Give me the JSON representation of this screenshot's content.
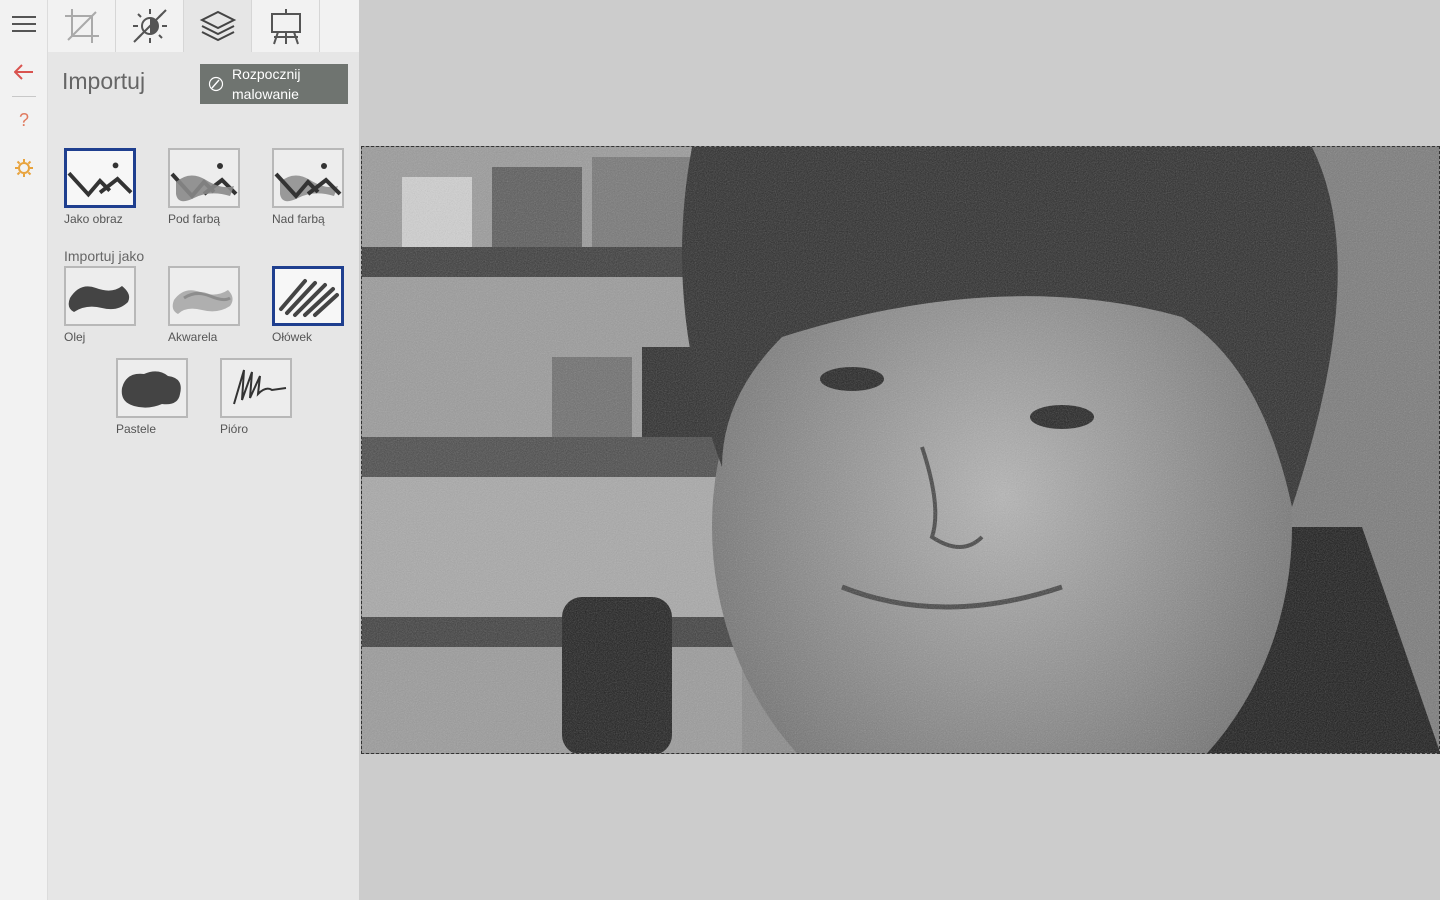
{
  "rail": {
    "items": [
      {
        "name": "menu",
        "icon": "hamburger-menu-icon"
      },
      {
        "name": "back",
        "icon": "arrow-left-icon",
        "color": "#d9534f"
      },
      {
        "name": "help",
        "icon": "question-mark-icon",
        "label": "?",
        "color": "#e07a5f"
      },
      {
        "name": "settings",
        "icon": "gear-icon",
        "color": "#e8a33d"
      }
    ]
  },
  "tabs": [
    {
      "name": "crop",
      "icon": "crop-icon"
    },
    {
      "name": "adjust",
      "icon": "brightness-icon"
    },
    {
      "name": "layers",
      "icon": "layers-icon",
      "active": true
    },
    {
      "name": "easel",
      "icon": "easel-icon"
    }
  ],
  "panel": {
    "title": "Importuj",
    "start_button": "Rozpocznij malowanie",
    "placement_options": [
      {
        "label": "Jako obraz",
        "selected": true
      },
      {
        "label": "Pod farbą",
        "selected": false
      },
      {
        "label": "Nad farbą",
        "selected": false
      }
    ],
    "import_as_label": "Importuj jako",
    "medium_options": [
      {
        "label": "Olej",
        "selected": false
      },
      {
        "label": "Akwarela",
        "selected": false
      },
      {
        "label": "Ołówek",
        "selected": true
      },
      {
        "label": "Pastele",
        "selected": false
      },
      {
        "label": "Pióro",
        "selected": false
      }
    ]
  },
  "colors": {
    "selection_border": "#1f3f8f",
    "start_button_bg": "#6f7470"
  }
}
